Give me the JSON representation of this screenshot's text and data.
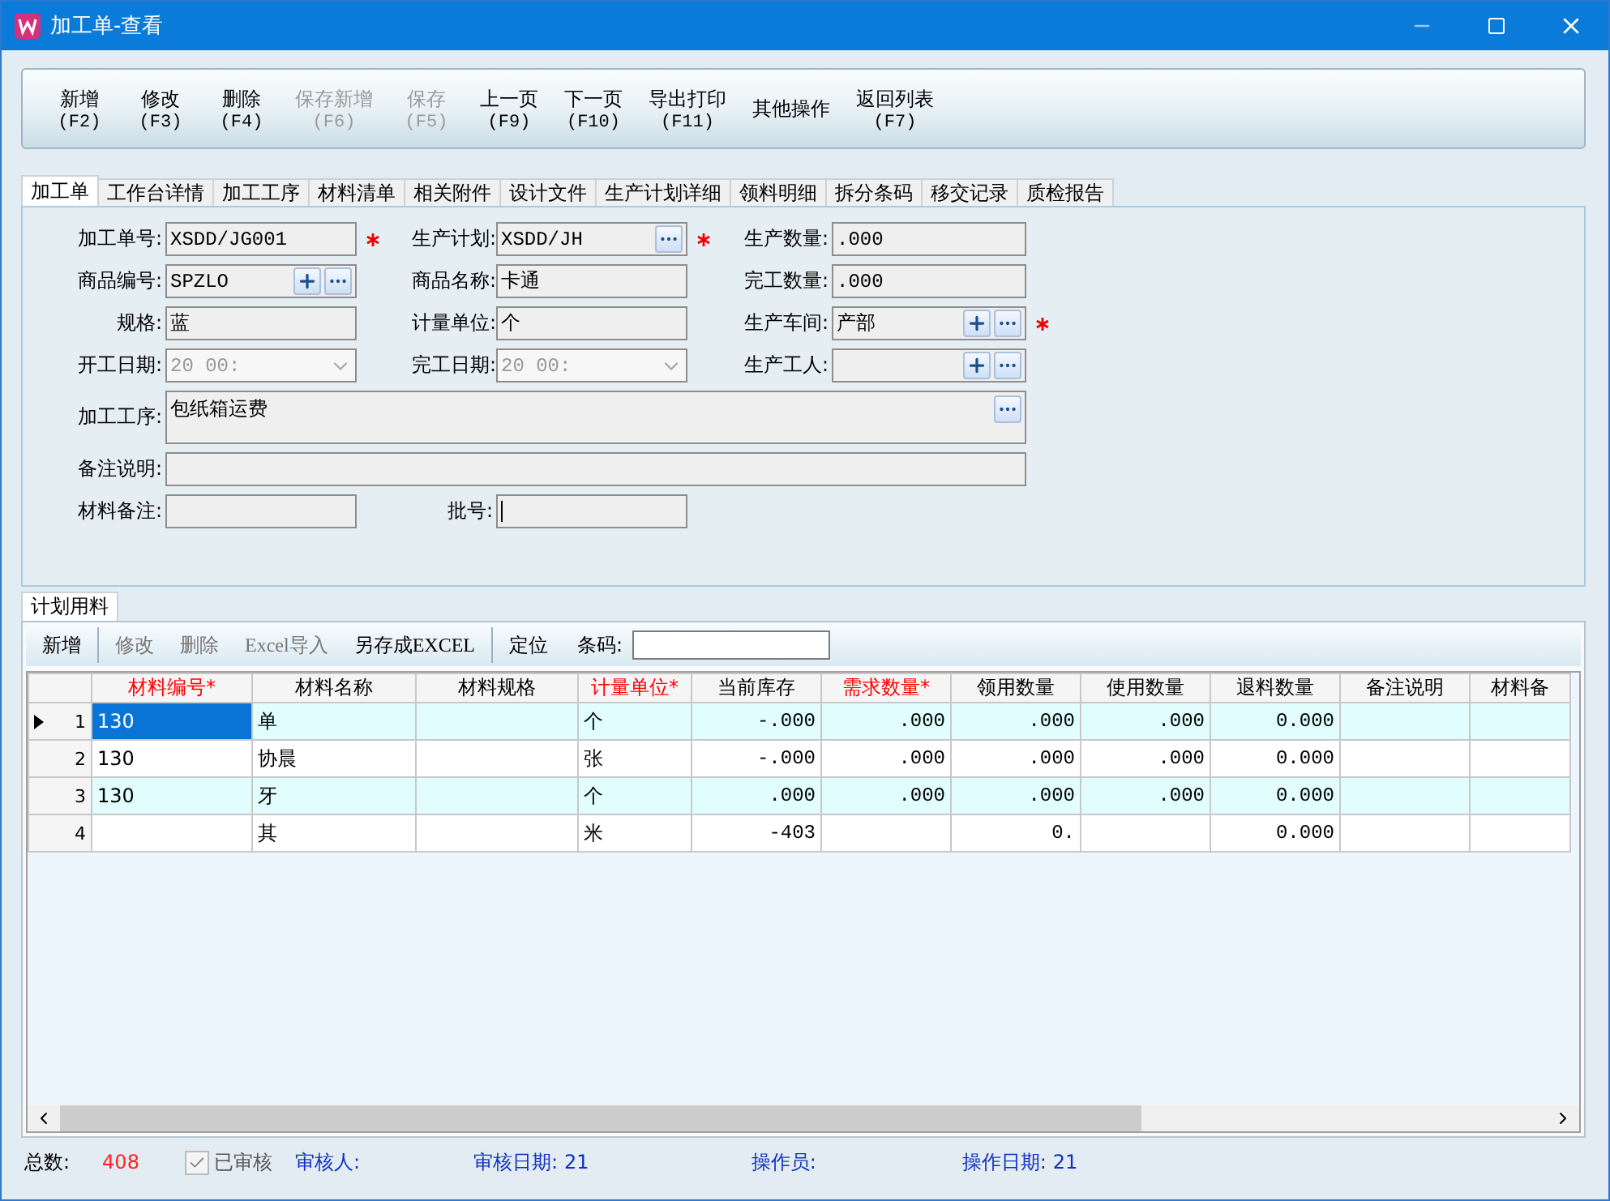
{
  "window": {
    "title": "加工单-查看"
  },
  "toolbar": {
    "buttons": [
      {
        "label": "新增",
        "shortcut": "(F2)",
        "disabled": false
      },
      {
        "label": "修改",
        "shortcut": "(F3)",
        "disabled": false
      },
      {
        "label": "删除",
        "shortcut": "(F4)",
        "disabled": false
      },
      {
        "label": "保存新增",
        "shortcut": "(F6)",
        "disabled": true
      },
      {
        "label": "保存",
        "shortcut": "(F5)",
        "disabled": true
      },
      {
        "label": "上一页",
        "shortcut": "(F9)",
        "disabled": false
      },
      {
        "label": "下一页",
        "shortcut": "(F10)",
        "disabled": false
      },
      {
        "label": "导出打印",
        "shortcut": "(F11)",
        "disabled": false
      },
      {
        "label": "其他操作",
        "disabled": false
      },
      {
        "label": "返回列表",
        "shortcut": "(F7)",
        "disabled": false
      }
    ]
  },
  "tabs": [
    {
      "label": "加工单",
      "selected": true
    },
    {
      "label": "工作台详情",
      "selected": false
    },
    {
      "label": "加工工序",
      "selected": false
    },
    {
      "label": "材料清单",
      "selected": false
    },
    {
      "label": "相关附件",
      "selected": false
    },
    {
      "label": "设计文件",
      "selected": false
    },
    {
      "label": "生产计划详细",
      "selected": false
    },
    {
      "label": "领料明细",
      "selected": false
    },
    {
      "label": "拆分条码",
      "selected": false
    },
    {
      "label": "移交记录",
      "selected": false
    },
    {
      "label": "质检报告",
      "selected": false
    }
  ],
  "form": {
    "rows": [
      [
        {
          "label": "加工单号:",
          "value": "XSDD/JG001",
          "kind": "text",
          "required": true
        },
        {
          "label": "生产计划:",
          "value": "XSDD/JH",
          "kind": "lookup",
          "required": true
        },
        {
          "label": "生产数量:",
          "value": ".000",
          "kind": "text"
        }
      ],
      [
        {
          "label": "商品编号:",
          "value": "SPZLO",
          "kind": "lookup-add"
        },
        {
          "label": "商品名称:",
          "value": "卡通",
          "kind": "text"
        },
        {
          "label": "完工数量:",
          "value": ".000",
          "kind": "text"
        }
      ],
      [
        {
          "label": "规格:",
          "value": "蓝",
          "kind": "text"
        },
        {
          "label": "计量单位:",
          "value": "个",
          "kind": "text"
        },
        {
          "label": "生产车间:",
          "value": "产部",
          "kind": "lookup-add",
          "required": true
        }
      ],
      [
        {
          "label": "开工日期:",
          "value": "20  00:",
          "kind": "date",
          "disabled": true
        },
        {
          "label": "完工日期:",
          "value": "20  00:",
          "kind": "date",
          "disabled": true
        },
        {
          "label": "生产工人:",
          "kind": "lookup-add"
        }
      ],
      [
        {
          "label": "加工工序:",
          "value": "包纸箱运费",
          "kind": "multiline"
        }
      ],
      [
        {
          "label": "备注说明:",
          "kind": "wide"
        }
      ],
      [
        {
          "label": "材料备注:",
          "kind": "text"
        },
        {
          "label": "批号:",
          "kind": "cursor"
        }
      ]
    ]
  },
  "sub_tabs": [
    {
      "label": "计划用料",
      "selected": true
    }
  ],
  "grid_toolbar": {
    "buttons": [
      {
        "label": "新增",
        "disabled": false
      },
      {
        "label": "修改",
        "disabled": true
      },
      {
        "label": "删除",
        "disabled": true
      },
      {
        "label": "Excel导入",
        "disabled": true
      },
      {
        "label": "另存成EXCEL",
        "disabled": false
      },
      {
        "label": "定位",
        "disabled": false
      }
    ],
    "barcode_label": "条码:"
  },
  "table": {
    "columns": [
      {
        "label": "材料编号*",
        "required": true
      },
      {
        "label": "材料名称",
        "required": false
      },
      {
        "label": "材料规格",
        "required": false
      },
      {
        "label": "计量单位*",
        "required": true
      },
      {
        "label": "当前库存",
        "required": false
      },
      {
        "label": "需求数量*",
        "required": true
      },
      {
        "label": "领用数量",
        "required": false
      },
      {
        "label": "使用数量",
        "required": false
      },
      {
        "label": "退料数量",
        "required": false
      },
      {
        "label": "备注说明",
        "required": false
      },
      {
        "label": "材料备",
        "required": false
      }
    ],
    "rows": [
      {
        "number": "1",
        "selected": true,
        "cells": [
          "130",
          "单",
          null,
          "个",
          "-.000",
          ".000",
          ".000",
          ".000",
          "0.000",
          null,
          null
        ]
      },
      {
        "number": "2",
        "selected": false,
        "cells": [
          "130",
          "协晨",
          null,
          "张",
          "-.000",
          ".000",
          ".000",
          ".000",
          "0.000",
          null,
          null
        ]
      },
      {
        "number": "3",
        "selected": false,
        "cells": [
          "130",
          "牙",
          null,
          "个",
          ".000",
          ".000",
          ".000",
          ".000",
          "0.000",
          null,
          null
        ]
      },
      {
        "number": "4",
        "selected": false,
        "cells": [
          null,
          "其",
          null,
          "米",
          "-403",
          null,
          "0.",
          null,
          "0.000",
          null,
          null
        ]
      }
    ]
  },
  "status_bar": {
    "total_label": "总数:",
    "total_value": "408",
    "approved": {
      "label": "已审核",
      "checked": true
    },
    "reviewer_label": "审核人:",
    "review_date_label": "审核日期:",
    "review_date_value": "21",
    "operator_label": "操作员:",
    "operate_date_label": "操作日期:",
    "operate_date_value": "21"
  }
}
